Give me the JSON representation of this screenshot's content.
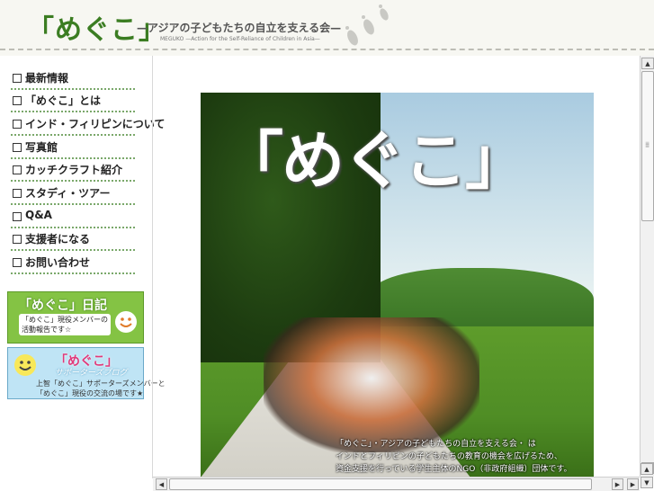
{
  "header": {
    "logo": "「めぐこ」",
    "tagline": "—アジアの子どもたちの自立を支える会—",
    "subtitle": "MEGUKO —Action for the Self-Reliance of Children in Asia—"
  },
  "sidebar": {
    "items": [
      {
        "label": "最新情報"
      },
      {
        "label": "「めぐこ」とは"
      },
      {
        "label": "インド・フィリピンについて"
      },
      {
        "label": "写真館"
      },
      {
        "label": "カッチクラフト紹介"
      },
      {
        "label": "スタディ・ツアー"
      },
      {
        "label": "Q&A"
      },
      {
        "label": "支援者になる"
      },
      {
        "label": "お問い合わせ"
      }
    ],
    "banners": [
      {
        "title": "「めぐこ」日記",
        "line1": "「めぐこ」現役メンバーの",
        "line2": "活動報告です☆"
      },
      {
        "title": "「めぐこ」",
        "script": "サポーターズブログ",
        "line1": "上智「めぐこ」サポーターズメンバーと",
        "line2": "「めぐこ」現役の交流の場です★"
      }
    ]
  },
  "hero": {
    "title": "「めぐこ」",
    "caption_line1": "「めぐこ」・アジアの子どもたちの自立を支える会・ は",
    "caption_line2": "インドとフィリピンの子どもたちの教育の機会を広げるため、",
    "caption_line3": "資金支援を行っている学生主体のNGO（非政府組織）団体です。"
  },
  "scrollbars": {
    "up_arrow": "▲",
    "down_arrow": "▼",
    "left_arrow": "◀",
    "right_arrow": "▶"
  }
}
